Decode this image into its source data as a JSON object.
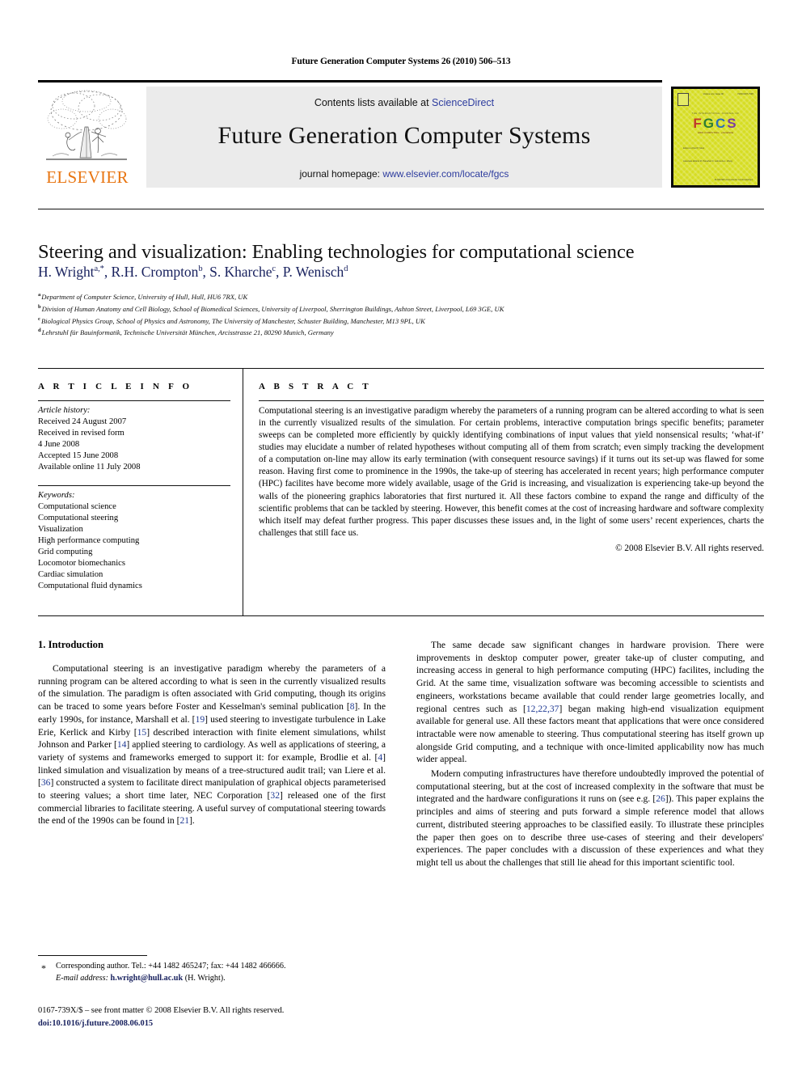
{
  "running_head": "Future Generation Computer Systems 26 (2010) 506–513",
  "masthead": {
    "contents_prefix": "Contents lists available at ",
    "sciencedirect": "ScienceDirect",
    "journal_title": "Future Generation Computer Systems",
    "homepage_prefix": "journal homepage: ",
    "homepage_url": "www.elsevier.com/locate/fgcs",
    "publisher": "ELSEVIER",
    "publisher_color": "#e87511",
    "band_color": "#ebebeb",
    "link_color": "#2d3c9e"
  },
  "cover": {
    "top_left": "Volume xxx  |  Issue 00",
    "top_right": "ISSN 0167-739X",
    "kicker": "THE INTERNATIONAL JOURNAL OF",
    "letters": [
      "F",
      "G",
      "C",
      "S"
    ],
    "subtitle": "GRID COMPUTING  ·  eSCIENCE",
    "block_a": "Editor-in-Chief\nP. Sloot",
    "block_b": "Associate Editors\nM. Parashar\nD. Laforenza\nL. Wang",
    "footer": "ELSEVIER\nwww.elsevier.com/locate/fgcs",
    "background": "#d6dd22"
  },
  "title": "Steering and visualization: Enabling technologies for computational science",
  "authors_html": "H. Wright<sup>a,*</sup>, R.H. Crompton<sup>b</sup>, S. Kharche<sup>c</sup>, P. Wenisch<sup>d</sup>",
  "authors_color": "#18215e",
  "affiliations": [
    {
      "marker": "a",
      "text": "Department of Computer Science, University of Hull, Hull, HU6 7RX, UK"
    },
    {
      "marker": "b",
      "text": "Division of Human Anatomy and Cell Biology, School of Biomedical Sciences, University of Liverpool, Sherrington Buildings, Ashton Street, Liverpool, L69 3GE, UK"
    },
    {
      "marker": "c",
      "text": "Biological Physics Group, School of Physics and Astronomy, The University of Manchester, Schuster Building, Manchester, M13 9PL, UK"
    },
    {
      "marker": "d",
      "text": "Lehrstuhl für Bauinformatik, Technische Universität München, Arcisstrasse 21, 80290 Munich, Germany"
    }
  ],
  "article_info": {
    "heading": "A R T I C L E    I N F O",
    "history_label": "Article history:",
    "history": [
      "Received 24 August 2007",
      "Received in revised form",
      "4 June 2008",
      "Accepted 15 June 2008",
      "Available online 11 July 2008"
    ],
    "keywords_label": "Keywords:",
    "keywords": [
      "Computational science",
      "Computational steering",
      "Visualization",
      "High performance computing",
      "Grid computing",
      "Locomotor biomechanics",
      "Cardiac simulation",
      "Computational fluid dynamics"
    ]
  },
  "abstract": {
    "heading": "A B S T R A C T",
    "text": "Computational steering is an investigative paradigm whereby the parameters of a running program can be altered according to what is seen in the currently visualized results of the simulation. For certain problems, interactive computation brings specific benefits; parameter sweeps can be completed more efficiently by quickly identifying combinations of input values that yield nonsensical results; ‘what-if’ studies may elucidate a number of related hypotheses without computing all of them from scratch; even simply tracking the development of a computation on-line may allow its early termination (with consequent resource savings) if it turns out its set-up was flawed for some reason. Having first come to prominence in the 1990s, the take-up of steering has accelerated in recent years; high performance computer (HPC) facilites have become more widely available, usage of the Grid is increasing, and visualization is experiencing take-up beyond the walls of the pioneering graphics laboratories that first nurtured it. All these factors combine to expand the range and difficulty of the scientific problems that can be tackled by steering. However, this benefit comes at the cost of increasing hardware and software complexity which itself may defeat further progress. This paper discusses these issues and, in the light of some users’ recent experiences, charts the challenges that still face us.",
    "copyright": "© 2008 Elsevier B.V. All rights reserved."
  },
  "body": {
    "section_number_title": "1.  Introduction",
    "left_paragraphs": [
      "Computational steering is an investigative paradigm whereby the parameters of a running program can be altered according to what is seen in the currently visualized results of the simulation. The paradigm is often associated with Grid computing, though its origins can be traced to some years before Foster and Kesselman's seminal publication [8]. In the early 1990s, for instance, Marshall et al. [19] used steering to investigate turbulence in Lake Erie, Kerlick and Kirby [15] described interaction with finite element simulations, whilst Johnson and Parker [14] applied steering to cardiology. As well as applications of steering, a variety of systems and frameworks emerged to support it: for example, Brodlie et al. [4] linked simulation and visualization by means of a tree-structured audit trail; van Liere et al. [36] constructed a system to facilitate direct manipulation of graphical objects parameterised to steering values; a short time later, NEC Corporation [32] released one of the first commercial libraries to facilitate steering. A useful survey of computational steering towards the end of the 1990s can be found in [21]."
    ],
    "right_paragraphs": [
      "The same decade saw significant changes in hardware provision. There were improvements in desktop computer power, greater take-up of cluster computing, and increasing access in general to high performance computing (HPC) facilites, including the Grid. At the same time, visualization software was becoming accessible to scientists and engineers, workstations became available that could render large geometries locally, and regional centres such as [12,22,37] began making high-end visualization equipment available for general use. All these factors meant that applications that were once considered intractable were now amenable to steering. Thus computational steering has itself grown up alongside Grid computing, and a technique with once-limited applicability now has much wider appeal.",
      "Modern computing infrastructures have therefore undoubtedly improved the potential of computational steering, but at the cost of increased  complexity in the software that must be integrated and the hardware configurations it runs on (see e.g. [26]). This paper explains the principles and aims of steering and puts forward a simple reference model that allows current, distributed steering approaches to be classified easily. To illustrate these principles the paper then goes on to describe three use-cases of steering and their developers' experiences. The paper concludes with a discussion of these experiences and what they might tell us about the challenges that still lie ahead for this important scientific tool."
    ]
  },
  "footnote": {
    "star": "*",
    "corresponding": "Corresponding author. Tel.: +44 1482 465247; fax: +44 1482 466666.",
    "email_label": "E-mail address:",
    "email": "h.wright@hull.ac.uk",
    "email_owner": "(H. Wright)."
  },
  "imprint": {
    "line1": "0167-739X/$ – see front matter © 2008 Elsevier B.V. All rights reserved.",
    "doi": "doi:10.1016/j.future.2008.06.015"
  }
}
